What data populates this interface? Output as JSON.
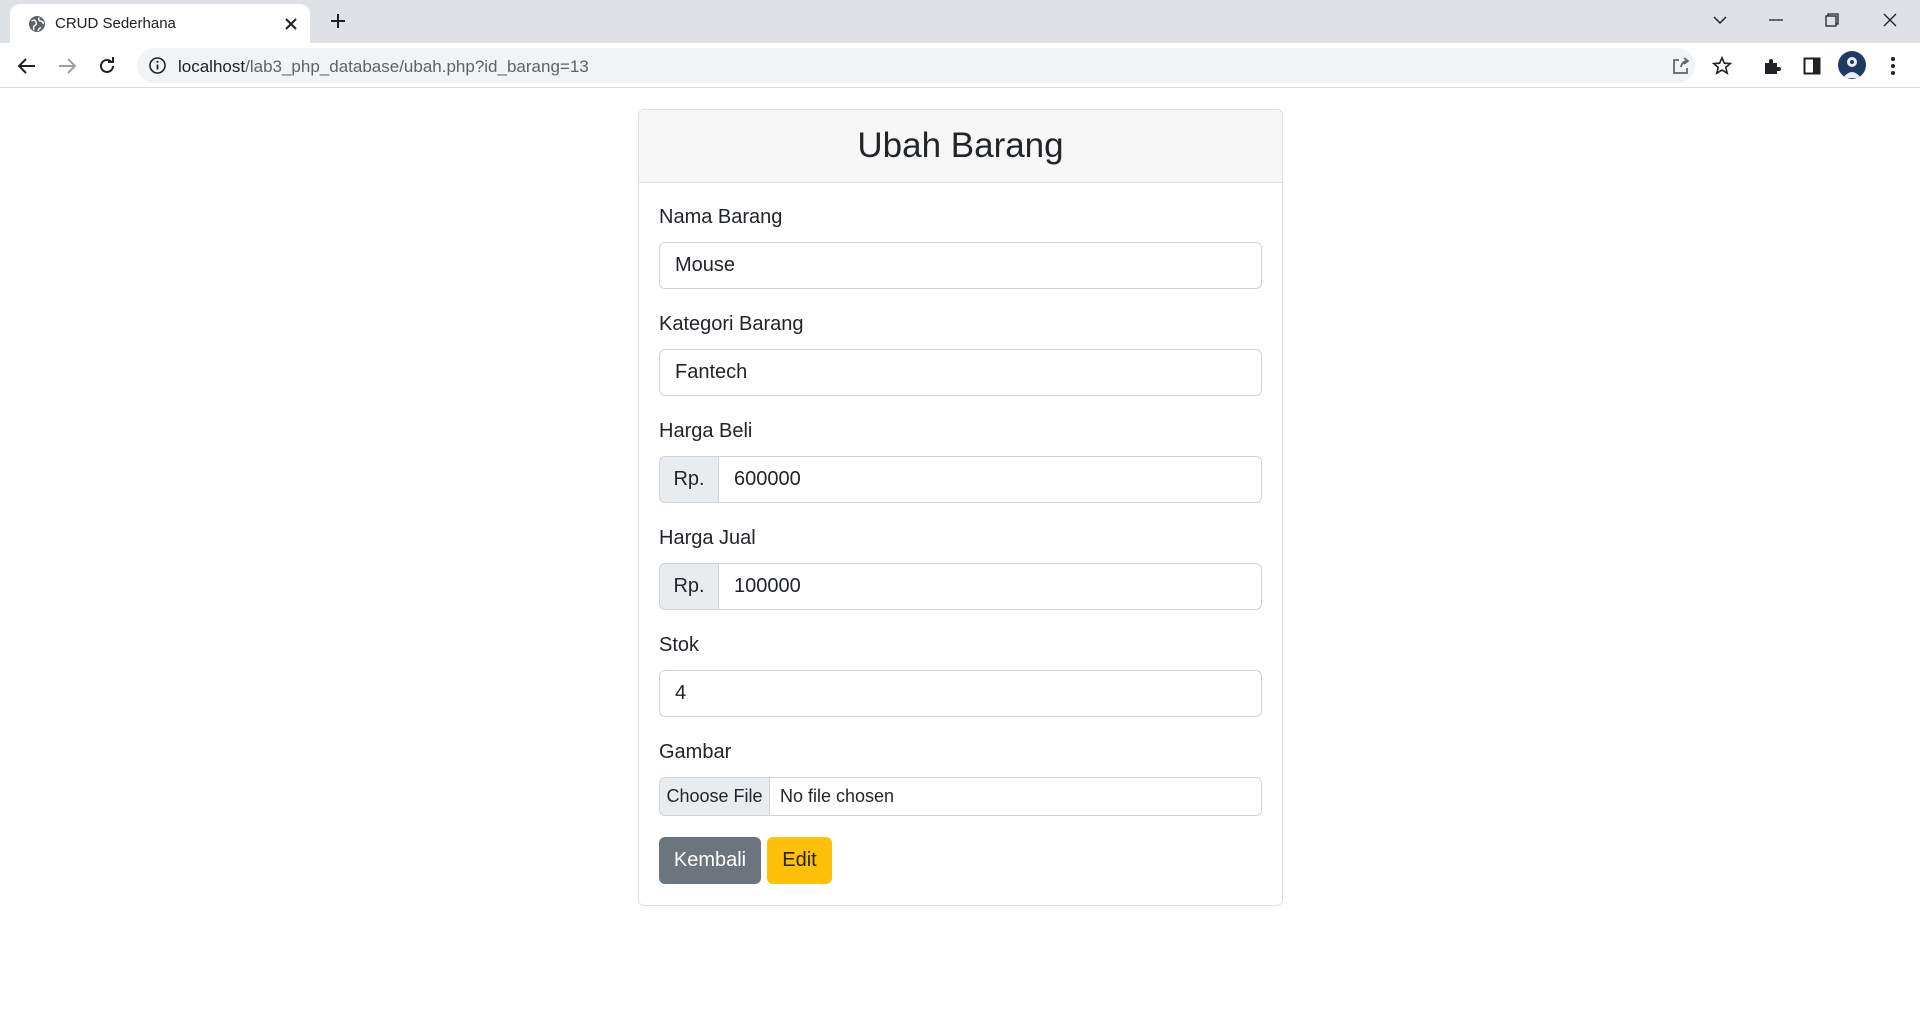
{
  "browser": {
    "tab_title": "CRUD Sederhana",
    "url_host": "localhost",
    "url_path": "/lab3_php_database/ubah.php?id_barang=13"
  },
  "form": {
    "title": "Ubah Barang",
    "nama": {
      "label": "Nama Barang",
      "value": "Mouse"
    },
    "kategori": {
      "label": "Kategori Barang",
      "value": "Fantech"
    },
    "harga_beli": {
      "label": "Harga Beli",
      "prefix": "Rp.",
      "value": "600000"
    },
    "harga_jual": {
      "label": "Harga Jual",
      "prefix": "Rp.",
      "value": "100000"
    },
    "stok": {
      "label": "Stok",
      "value": "4"
    },
    "gambar": {
      "label": "Gambar",
      "button": "Choose File",
      "status": "No file chosen"
    },
    "back_button": "Kembali",
    "edit_button": "Edit"
  },
  "colors": {
    "back_button": "#6c757d",
    "edit_button": "#ffc107",
    "header_bg": "#f7f7f7"
  },
  "icons": [
    "globe-icon",
    "close-icon",
    "plus-icon",
    "chevron-down-icon",
    "minimize-icon",
    "restore-icon",
    "back-arrow-icon",
    "forward-arrow-icon",
    "reload-icon",
    "info-icon",
    "share-icon",
    "star-icon",
    "extensions-icon",
    "side-panel-icon",
    "more-icon"
  ]
}
